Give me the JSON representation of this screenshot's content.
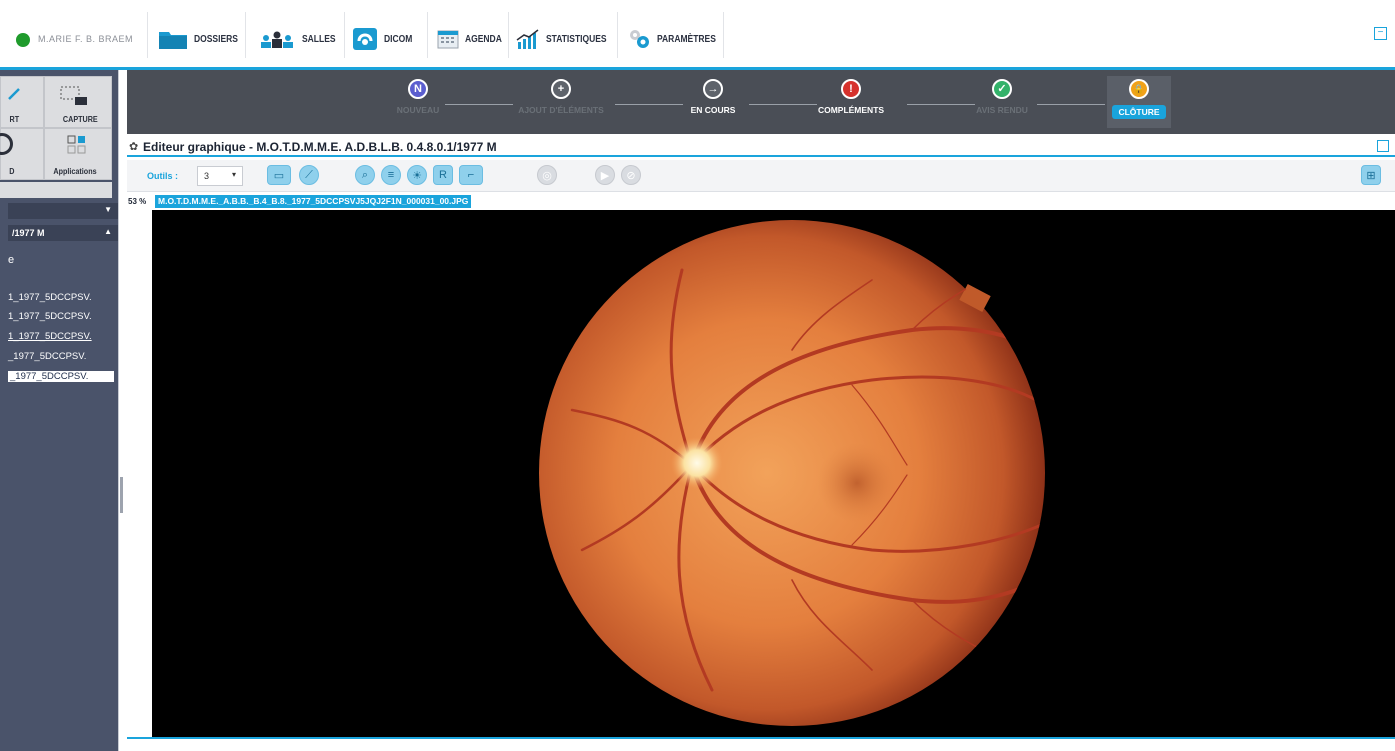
{
  "topbar": {
    "user": "M.ARIE F. B. BRAEM",
    "nav": [
      {
        "label": "DOSSIERS",
        "icon": "folder-icon"
      },
      {
        "label": "SALLES",
        "icon": "people-icon"
      },
      {
        "label": "DICOM",
        "icon": "dicom-icon"
      },
      {
        "label": "AGENDA",
        "icon": "calendar-icon"
      },
      {
        "label": "STATISTIQUES",
        "icon": "chart-icon"
      },
      {
        "label": "PARAMÈTRES",
        "icon": "gears-icon"
      }
    ],
    "minimize": "−"
  },
  "left_panel": {
    "tools": [
      {
        "label": "RT"
      },
      {
        "label": "CAPTURE"
      },
      {
        "label": "D"
      },
      {
        "label": "Applications"
      }
    ],
    "patient_header": "/1977 M",
    "small_label": "e",
    "files": [
      "1_1977_5DCCPSV.",
      "1_1977_5DCCPSV.",
      "1_1977_5DCCPSV.",
      "_1977_5DCCPSV.",
      "_1977_5DCCPSV."
    ]
  },
  "workflow": {
    "steps": [
      {
        "label": "NOUVEAU",
        "symbol": "N",
        "color": "#5b5ecf",
        "state": "dim"
      },
      {
        "label": "AJOUT D'ÉLÉMENTS",
        "symbol": "+",
        "color": "#5e636b",
        "state": "dim"
      },
      {
        "label": "EN COURS",
        "symbol": "→",
        "color": "#5e636b",
        "state": "normal"
      },
      {
        "label": "COMPLÉMENTS",
        "symbol": "!",
        "color": "#d6322d",
        "state": "normal"
      },
      {
        "label": "AVIS RENDU",
        "symbol": "✓",
        "color": "#33b26a",
        "state": "dim"
      },
      {
        "label": "CLÔTURE",
        "symbol": "🔒",
        "color": "#f0a21a",
        "state": "active"
      }
    ]
  },
  "editor": {
    "title": "Editeur graphique - M.O.T.D.M.M.E. A.D.B.L.B. 0.4.8.0.1/1977 M",
    "tools_label": "Outils :",
    "tools_value": "3",
    "zoom": "53 %",
    "filename": "M.O.T.D.M.M.E._A.B.B._B.4_B.8._1977_5DCCPSVJ5JQJ2F1N_000031_00.JPG"
  },
  "colors": {
    "accent": "#1aa4dc",
    "panel": "#4a536a",
    "workflow_bg": "#4a4e56"
  }
}
